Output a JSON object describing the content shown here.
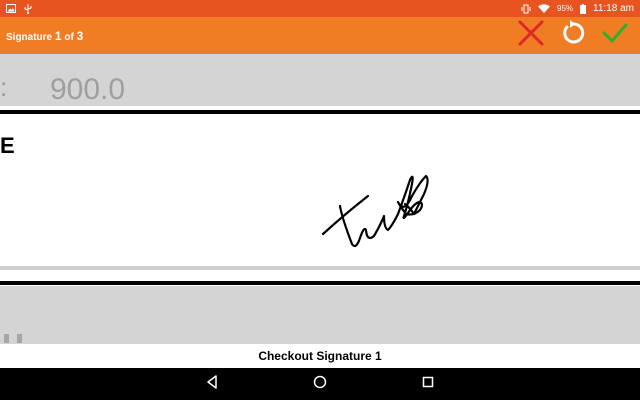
{
  "status_bar": {
    "battery_percent": "95%",
    "time": "11:18 am"
  },
  "app_bar": {
    "title_prefix": "Signature ",
    "title_current": "1",
    "title_of": " of ",
    "title_total": "3"
  },
  "actions": {
    "cancel_icon": "close-icon",
    "reset_icon": "refresh-icon",
    "confirm_icon": "check-icon"
  },
  "document": {
    "amount_colon": ":",
    "amount_value": "900.0",
    "left_letter": "E"
  },
  "caption": {
    "text": "Checkout Signature 1"
  },
  "nav": {
    "back_icon": "back-triangle-icon",
    "home_icon": "home-circle-icon",
    "recents_icon": "recents-square-icon"
  },
  "colors": {
    "status_bar": "#e8541f",
    "app_bar": "#f07c24",
    "cancel": "#e0252b",
    "confirm": "#2bb02b"
  }
}
